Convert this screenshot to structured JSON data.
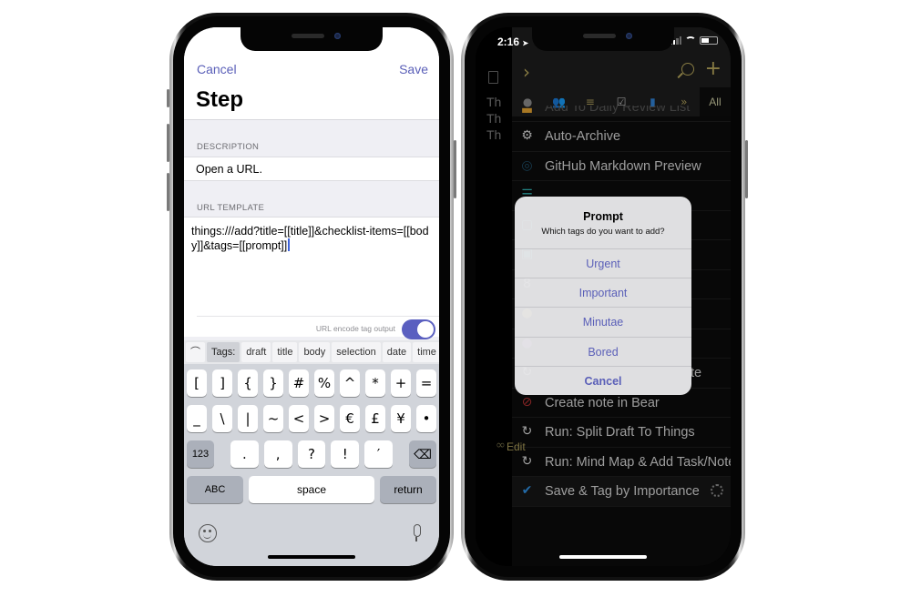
{
  "left_phone": {
    "nav": {
      "cancel_label": "Cancel",
      "save_label": "Save",
      "title": "Step"
    },
    "description": {
      "header": "DESCRIPTION",
      "value": "Open a URL."
    },
    "url_template": {
      "header": "URL TEMPLATE",
      "value": "things:///add?title=[[title]]&checklist-items=[[body]]&tags=[[prompt]]",
      "toggle_label": "URL encode tag output",
      "toggle_on": true
    },
    "keyboard": {
      "tag_bar": {
        "collapse_glyph": "⌒",
        "label": "Tags:",
        "tags": [
          "draft",
          "title",
          "body",
          "selection",
          "date",
          "time"
        ]
      },
      "row1": [
        "[",
        "]",
        "{",
        "}",
        "#",
        "%",
        "^",
        "*",
        "+",
        "="
      ],
      "row2": [
        "_",
        "\\",
        "|",
        "~",
        "<",
        ">",
        "€",
        "£",
        "¥",
        "•"
      ],
      "row3": {
        "mode_key": "123",
        "keys": [
          ".",
          ",",
          "?",
          "!",
          "′"
        ],
        "delete_glyph": "⌫"
      },
      "row4": {
        "abc_key": "ABC",
        "space_key": "space",
        "return_key": "return"
      },
      "emoji_icon": "emoji-icon",
      "mic_icon": "microphone-icon"
    }
  },
  "right_phone": {
    "status_bar": {
      "time": "2:16",
      "location_glyph": "➤"
    },
    "background_editor": {
      "lines": [
        "Th",
        "Th",
        "Th"
      ]
    },
    "header": {
      "chevron_glyph": "›",
      "plus_glyph": "+"
    },
    "filter_bar": {
      "items": [
        {
          "name": "search-filter",
          "glyph": "●",
          "color": "#8a8a8a"
        },
        {
          "name": "people-filter",
          "glyph": "👥",
          "color": "#4a7fc0"
        },
        {
          "name": "list-filter",
          "glyph": "≡",
          "color": "#a89a58"
        },
        {
          "name": "check-filter",
          "glyph": "☑",
          "color": "#bbbbbb"
        },
        {
          "name": "book-filter",
          "glyph": "▮",
          "color": "#2f7fd0"
        },
        {
          "name": "more-filter",
          "glyph": "»",
          "color": "#a89a58"
        }
      ],
      "all_label": "All"
    },
    "actions": [
      {
        "label": "Add To Daily Review List",
        "glyph": "▬",
        "color": "#e0a030"
      },
      {
        "label": "Auto-Archive",
        "glyph": "⚙",
        "color": "#d8d8d8"
      },
      {
        "label": "GitHub Markdown Preview",
        "glyph": "◎",
        "color": "#1f4f6a"
      },
      {
        "label": "",
        "glyph": "☰",
        "color": "#2fb0b0"
      },
      {
        "label": "",
        "glyph": "▢",
        "color": "#2fb0b0"
      },
      {
        "label": "",
        "glyph": "▣",
        "color": "#2fb0b0"
      },
      {
        "label": "",
        "glyph": "8",
        "color": "#bbbbbb"
      },
      {
        "label": "",
        "glyph": "●",
        "color": "#c8b830"
      },
      {
        "label": "",
        "glyph": "●",
        "color": "#8a4fb0"
      },
      {
        "label": "te",
        "glyph": "↻",
        "color": "#d8d8d8"
      },
      {
        "label": "Create note in Bear",
        "glyph": "⊘",
        "color": "#b03030"
      },
      {
        "label": "Run: Split Draft To Things",
        "glyph": "↻",
        "color": "#d8d8d8"
      },
      {
        "label": "Run: Mind Map & Add Task/Notes",
        "glyph": "↻",
        "color": "#d8d8d8"
      },
      {
        "label": "Save & Tag by Importance",
        "glyph": "✔",
        "color": "#2f8fe0"
      }
    ],
    "edit_label": "Edit",
    "prompt": {
      "title": "Prompt",
      "message": "Which tags do you want to add?",
      "options": [
        "Urgent",
        "Important",
        "Minutae",
        "Bored"
      ],
      "cancel_label": "Cancel"
    }
  }
}
